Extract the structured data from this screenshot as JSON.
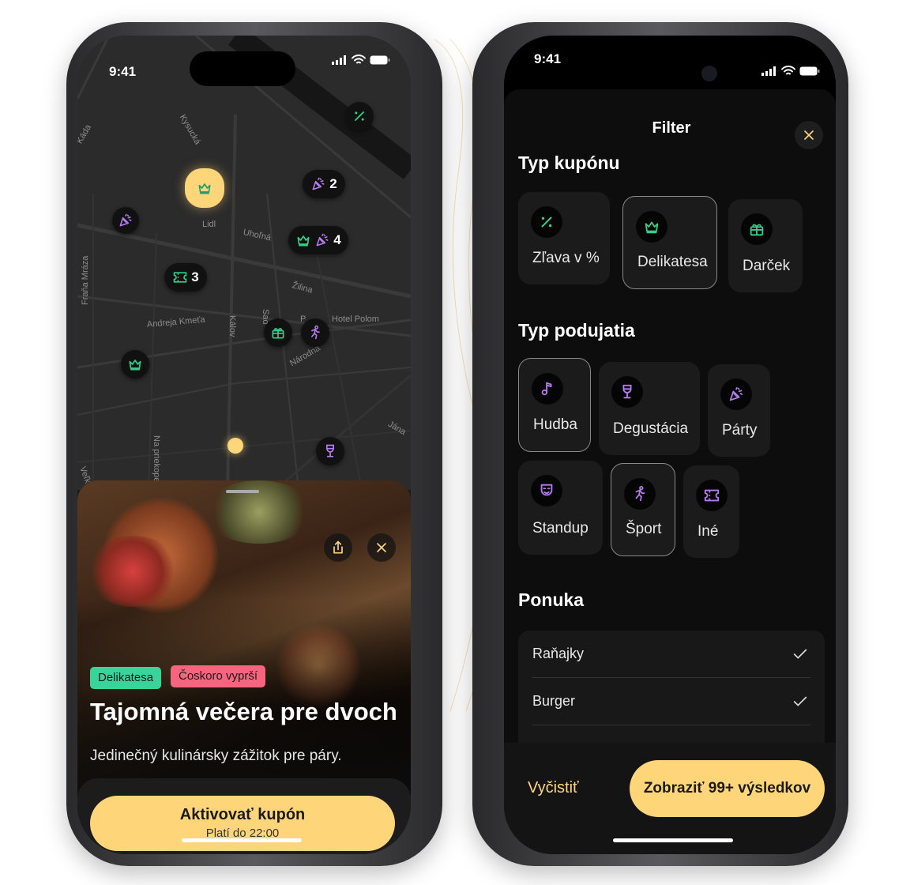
{
  "colors": {
    "accent_yellow": "#ffd57a",
    "green": "#2fd08a",
    "purple": "#b57cf0",
    "pink": "#f6657e",
    "background": "#000000"
  },
  "left_phone": {
    "status": {
      "time": "9:41"
    },
    "map": {
      "streets": [
        "Káda",
        "Kysucká",
        "Lidl",
        "Uhoľná",
        "Žilina",
        "Fraňa Mráza",
        "Andreja Kmeťa",
        "Kálov",
        "Sad",
        "P",
        "Hotel Polom",
        "Národná",
        "Jána",
        "Na priekope",
        "Veľká"
      ],
      "markers": [
        {
          "icons": [
            "percent-icon"
          ],
          "count": ""
        },
        {
          "icons": [
            "crown-icon"
          ],
          "count": "",
          "highlighted": true
        },
        {
          "icons": [
            "party-icon"
          ],
          "count": "2"
        },
        {
          "icons": [
            "party-icon"
          ],
          "count": ""
        },
        {
          "icons": [
            "crown-icon",
            "party-icon"
          ],
          "count": "4"
        },
        {
          "icons": [
            "ticket-icon"
          ],
          "count": "3"
        },
        {
          "icons": [
            "gift-icon"
          ],
          "count": ""
        },
        {
          "icons": [
            "sport-icon"
          ],
          "count": ""
        },
        {
          "icons": [
            "crown-icon"
          ],
          "count": ""
        },
        {
          "icons": [
            "wine-icon"
          ],
          "count": ""
        }
      ]
    },
    "coupon": {
      "tags": [
        "Delikatesa",
        "Čoskoro vyprší"
      ],
      "title": "Tajomná večera pre dvoch",
      "description": "Jedinečný kulinársky zážitok pre páry.",
      "cta_label": "Aktivovať kupón",
      "cta_sub": "Platí do 22:00"
    }
  },
  "right_phone": {
    "status": {
      "time": "9:41"
    },
    "filter": {
      "title": "Filter",
      "coupon_type": {
        "heading": "Typ kupónu",
        "options": [
          {
            "label": "Zľava v %",
            "icon": "percent-icon",
            "selected": false
          },
          {
            "label": "Delikatesa",
            "icon": "crown-icon",
            "selected": true
          },
          {
            "label": "Darček",
            "icon": "gift-icon",
            "selected": false
          }
        ]
      },
      "event_type": {
        "heading": "Typ podujatia",
        "options": [
          {
            "label": "Hudba",
            "icon": "music-note-icon",
            "selected": true
          },
          {
            "label": "Degustácia",
            "icon": "wine-icon",
            "selected": false
          },
          {
            "label": "Párty",
            "icon": "party-icon",
            "selected": false
          },
          {
            "label": "Standup",
            "icon": "theater-mask-icon",
            "selected": false
          },
          {
            "label": "Šport",
            "icon": "sport-icon",
            "selected": true
          },
          {
            "label": "Iné",
            "icon": "ticket-icon",
            "selected": false
          }
        ]
      },
      "offer": {
        "heading": "Ponuka",
        "items": [
          {
            "label": "Raňajky",
            "checked": true
          },
          {
            "label": "Burger",
            "checked": true
          }
        ]
      },
      "clear_label": "Vyčistiť",
      "show_results_label": "Zobraziť 99+ výsledkov"
    }
  }
}
